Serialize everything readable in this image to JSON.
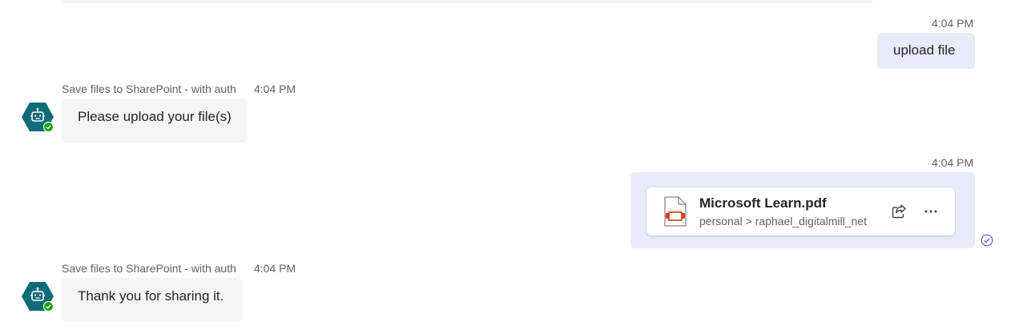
{
  "messages": [
    {
      "direction": "outgoing",
      "time": "4:04 PM",
      "text": "upload file"
    },
    {
      "direction": "incoming",
      "sender": "Save files to SharePoint - with auth",
      "time": "4:04 PM",
      "text": "Please upload your file(s)"
    },
    {
      "direction": "outgoing",
      "time": "4:04 PM",
      "attachment": {
        "name": "Microsoft Learn.pdf",
        "path": "personal > raphael_digitalmill_net",
        "icon": "pdf-file-icon"
      },
      "status_icon": "delivered-check-icon"
    },
    {
      "direction": "incoming",
      "sender": "Save files to SharePoint - with auth",
      "time": "4:04 PM",
      "text": "Thank you for sharing it."
    }
  ],
  "colors": {
    "outgoing_bubble": "#e8ebfa",
    "incoming_bubble": "#f5f5f5",
    "bot_avatar": "#0f6b7a",
    "presence_available": "#13a10e",
    "pdf_accent": "#d83b01",
    "status_check": "#5b5fc7"
  }
}
